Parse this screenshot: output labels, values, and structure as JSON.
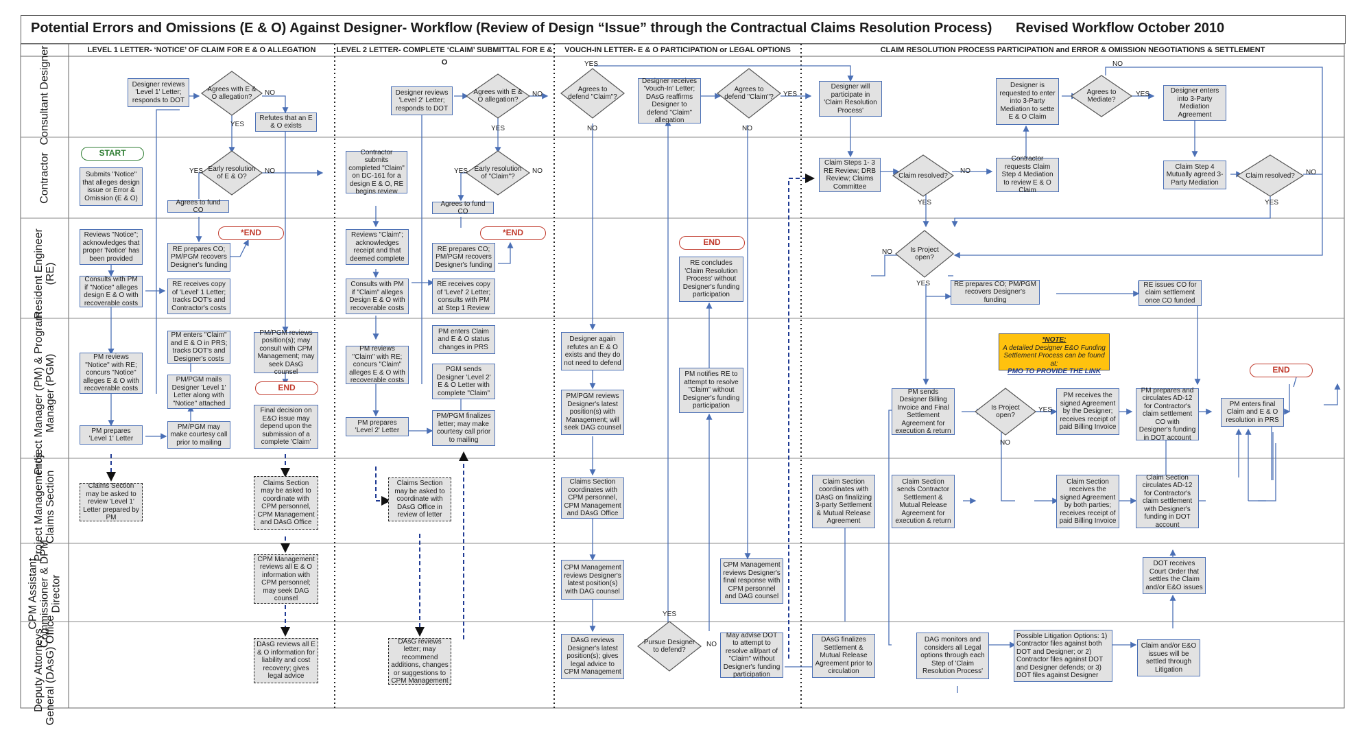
{
  "header": {
    "title": "Potential Errors and Omissions (E & O) Against Designer- Workflow (Review of Design “Issue” through the Contractual Claims Resolution Process)",
    "revised": "Revised Workflow October 2010"
  },
  "phases": [
    "LEVEL 1 LETTER-  ‘NOTICE’ OF CLAIM FOR E & O ALLEGATION",
    "LEVEL 2 LETTER-  COMPLETE ‘CLAIM’ SUBMITTAL FOR E & O",
    "VOUCH-IN LETTER-  E & O PARTICIPATION or  LEGAL OPTIONS",
    "CLAIM RESOLUTION PROCESS PARTICIPATION and ERROR & OMISSION NEGOTIATIONS & SETTLEMENT"
  ],
  "lanes": [
    "Consultant Designer",
    "Contractor",
    "Resident Engineer (RE)",
    "Project Manager (PM) & Program Manager (PGM)",
    "Project Management's Claims Section",
    "CPM Assistant Commissioner & DPM Director",
    "Deputy Attorneys General (DAsG) Office"
  ],
  "terminals": {
    "start": "START",
    "end_star": "*END",
    "end": "END"
  },
  "labels": {
    "yes": "YES",
    "no": "NO"
  },
  "boxes": {
    "b1": "Designer reviews 'Level 1' Letter; responds to DOT",
    "b2": "Refutes that an E & O exists",
    "b3": "Submits \"Notice\" that alleges design issue or Error & Omission (E & O)",
    "b4": "Agrees to fund CO",
    "b5": "Reviews \"Notice\"; acknowledges that proper 'Notice' has been provided",
    "b6": "Consults with PM if \"Notice\" alleges design E & O with recoverable costs",
    "b7": "RE prepares CO; PM/PGM recovers Designer's funding",
    "b8": "RE receives copy of 'Level' 1 Letter; tracks DOT's and Contractor's costs",
    "b9": "PM reviews \"Notice\" with RE; concurs \"Notice\" alleges E & O with recoverable costs",
    "b10": "PM enters \"Claim\" and E & O in PRS; tracks DOT's and Designer's costs",
    "b11": "PM/PGM mails Designer 'Level 1' Letter along with \"Notice\" attached",
    "b12": "PM prepares 'Level 1' Letter",
    "b13": "PM/PGM may make courtesy call prior to mailing",
    "b14": "PM/PGM reviews position(s); may consult with CPM Management; may seek DAsG counsel",
    "b15": "Final decision on E&O issue may depend upon the submission of a complete 'Claim'",
    "b16": "Claims Section may be asked to review 'Level 1' Letter prepared by PM",
    "b17": "Claims Section may be asked to coordinate with CPM personnel, CPM Management and DAsG Office",
    "b18": "CPM Management reviews all E & O information with CPM personnel; may seek DAG counsel",
    "b19": "DAsG reviews all E & O information for liability and cost recovery; gives legal advice",
    "c1": "Designer reviews 'Level 2' Letter; responds to DOT",
    "c2": "Contractor submits completed \"Claim\" on DC-161 for a design E & O, RE begins review",
    "c3": "Agrees to fund CO",
    "c4": "Reviews \"Claim\"; acknowledges receipt and that deemed complete",
    "c5": "RE prepares CO; PM/PGM recovers Designer's funding",
    "c6": "Consults with PM if \"Claim\" alleges Design E & O with recoverable costs",
    "c7": "RE receives copy of 'Level' 2 Letter; consults with PM at Step 1 Review",
    "c8": "PM enters Claim and E & O status changes in PRS",
    "c9": "PM reviews \"Claim\" with RE; concurs \"Claim\" alleges E & O with recoverable costs",
    "c10": "PGM sends Designer 'Level 2' E & O Letter with complete \"Claim\"",
    "c11": "PM prepares 'Level 2' Letter",
    "c12": "PM/PGM finalizes letter; may make courtesy call prior to mailing",
    "c13": "Claims Section may be asked to coordinate with DAsG Office in review of letter",
    "c14": "DAsG reviews letter; may recommend additions, changes or suggestions to CPM Management",
    "d1": "Designer receives 'Vouch-In' Letter; DAsG reaffirms Designer to defend \"Claim\" allegation",
    "d2": "Designer again refutes an E & O exists and they do not need to defend",
    "d3": "PM/PGM reviews Designer's latest position(s) with Management; will seek DAG counsel",
    "d4": "Claims Section coordinates with CPM personnel, CPM Management and DAsG Office",
    "d5": "CPM Management reviews Designer's latest position(s) with DAG counsel",
    "d6": "DAsG reviews Designer's latest position(s); gives legal advice to CPM Management",
    "d7": "RE concludes 'Claim Resolution Process' without Designer's funding participation",
    "d8": "PM notifies RE to attempt to resolve \"Claim\" without Designer's funding participation",
    "d9": "CPM Management reviews Designer's final response with CPM personnel and DAG counsel",
    "d10": "May advise DOT to attempt to resolve all/part of \"Claim\" without Designer's funding participation",
    "e1": "Designer will participate in 'Claim Resolution Process'",
    "e2": "Claim Steps 1- 3 RE Review; DRB Review; Claims Committee",
    "e3": "Contractor requests Claim Step 4 Mediation to review E & O Claim",
    "e4": "Designer is requested to enter into 3-Party Mediation to sette E & O Claim",
    "e5": "Designer enters into 3-Party Mediation Agreement",
    "e6": "Claim Step 4 Mutually agreed 3-Party Mediation",
    "e7": "RE prepares CO; PM/PGM recovers Designer's funding",
    "e8": "RE issues CO for claim settlement once CO funded",
    "e9": "PM sends Designer Billing Invoice and Final Settlement Agreement for execution & return",
    "e10": "PM receives the signed Agreement by the Designer; receives receipt of paid Billing Invoice",
    "e11": "PM prepares and circulates AD-12 for Contractor's claim settlement CO with Designer's funding in DOT account",
    "e12": "PM enters final Claim and E & O resolution in PRS",
    "e13": "Claim Section coordinates with DAsG on finalizing 3-party Settlement & Mutual Release Agreement",
    "e14": "Claim Section sends Contractor Settlement & Mutual Release Agreement for execution & return",
    "e15": "Claim Section receives the signed Agreement by both parties; receives receipt of paid Billing Invoice",
    "e16": "Claim Section circulates AD-12 for Contractor's claim settlement with Designer's funding in DOT account",
    "e17": "DOT receives Court Order that settles the Claim and/or E&O issues",
    "e18": "DAsG finalizes Settlement & Mutual Release Agreement prior to circulation",
    "e19": "DAG monitors and considers all Legal options through each Step of 'Claim Resolution Process'",
    "e20": "Possible Litigation Options: 1) Contractor files against both DOT and Designer; or 2) Contractor files against DOT and Designer defends; or 3) DOT files against Designer",
    "e21": "Claim and/or E&O issues will be settled through Litigation"
  },
  "diamonds": {
    "q1": "Agrees with E & O allegation?",
    "q2": "Early resolution of E & O?",
    "q3": "Agrees with E & O allegation?",
    "q4": "Early resolution of \"Claim\"?",
    "q5": "Agrees to defend \"Claim\"?",
    "q6": "Agrees to defend \"Claim\"?",
    "q7": "Pursue Designer to defend?",
    "q8": "Claim resolved?",
    "q9": "Agrees to Mediate?",
    "q10": "Claim resolved?",
    "q11": "Is Project open?",
    "q12": "Is Project open?"
  },
  "note": {
    "title": "*NOTE:",
    "body": "A detailed Designer E&O Funding Settlement Process can be found at:",
    "link": "PMO TO PROVIDE THE LINK"
  }
}
